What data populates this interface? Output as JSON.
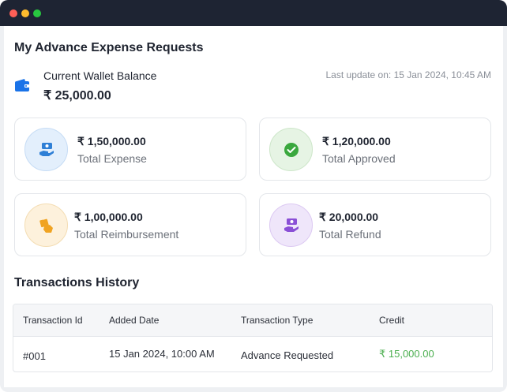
{
  "page": {
    "title": "My Advance Expense Requests"
  },
  "wallet": {
    "label": "Current Wallet Balance",
    "amount": "₹ 25,000.00",
    "last_update": "Last update on: 15 Jan 2024, 10:45 AM",
    "icon": "wallet-icon"
  },
  "stats": [
    {
      "amount": "₹ 1,50,000.00",
      "label": "Total Expense",
      "icon": "money-hand-icon",
      "color": "#2e7fd6"
    },
    {
      "amount": "₹ 1,20,000.00",
      "label": "Total Approved",
      "icon": "check-circle-icon",
      "color": "#3aa83e"
    },
    {
      "amount": "₹ 1,00,000.00",
      "label": "Total Reimbursement",
      "icon": "reimbursement-icon",
      "color": "#f0a321"
    },
    {
      "amount": "₹ 20,000.00",
      "label": "Total Refund",
      "icon": "refund-icon",
      "color": "#8a4fd6"
    }
  ],
  "transactions": {
    "title": "Transactions History",
    "columns": [
      "Transaction Id",
      "Added Date",
      "Transaction Type",
      "Credit"
    ],
    "rows": [
      {
        "id": "#001",
        "date": "15 Jan 2024, 10:00 AM",
        "type": "Advance Requested",
        "credit": "₹ 15,000.00"
      }
    ]
  },
  "colors": {
    "credit": "#4caf50",
    "titlebar": "#1e2433"
  }
}
